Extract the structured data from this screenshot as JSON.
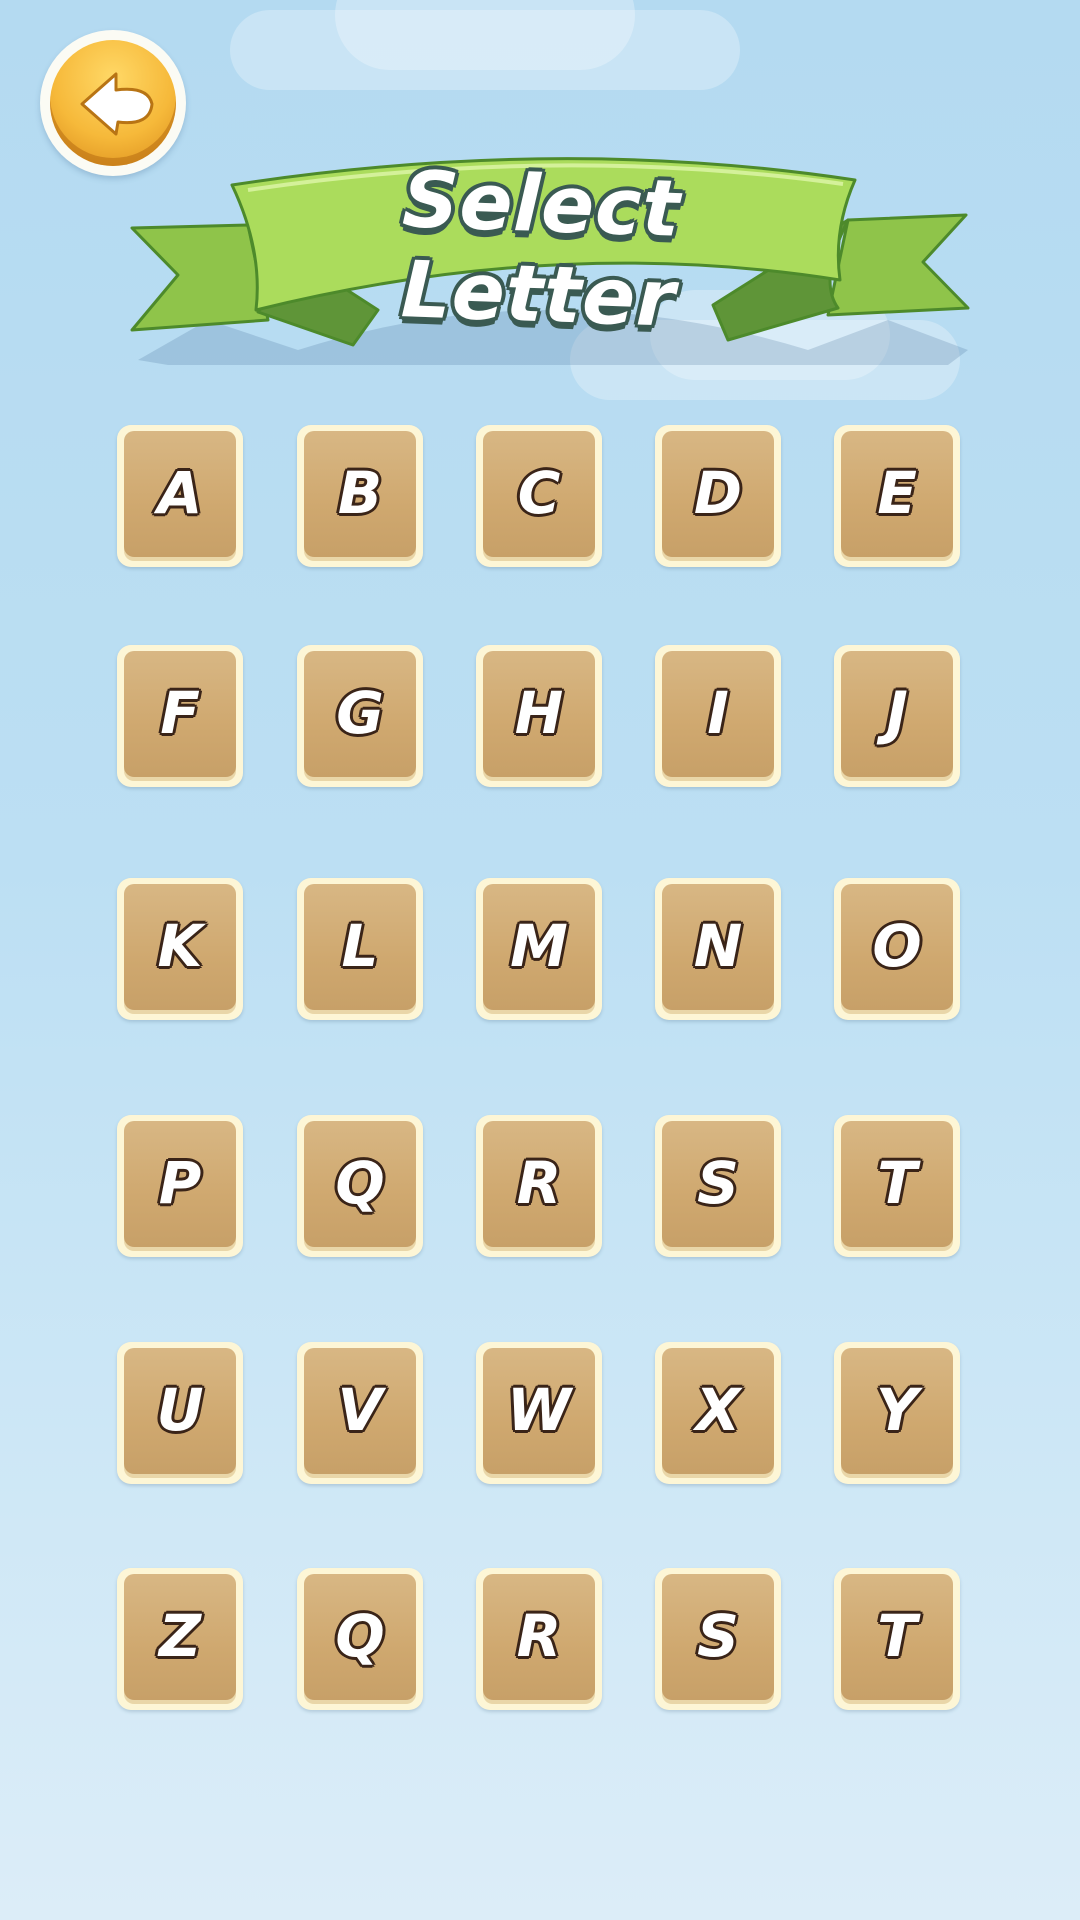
{
  "header": {
    "title": "Select Letter",
    "back_icon": "back-arrow-icon"
  },
  "colors": {
    "sky": "#b4daf1",
    "banner_green": "#a8d95a",
    "back_button_orange": "#f6b93a",
    "tile_tan": "#cfa86f",
    "tile_border": "#fdf6d6"
  },
  "letters": {
    "rows": [
      [
        "A",
        "B",
        "C",
        "D",
        "E"
      ],
      [
        "F",
        "G",
        "H",
        "I",
        "J"
      ],
      [
        "K",
        "L",
        "M",
        "N",
        "O"
      ],
      [
        "P",
        "Q",
        "R",
        "S",
        "T"
      ],
      [
        "U",
        "V",
        "W",
        "X",
        "Y"
      ],
      [
        "Z",
        "Q",
        "R",
        "S",
        "T"
      ]
    ]
  }
}
